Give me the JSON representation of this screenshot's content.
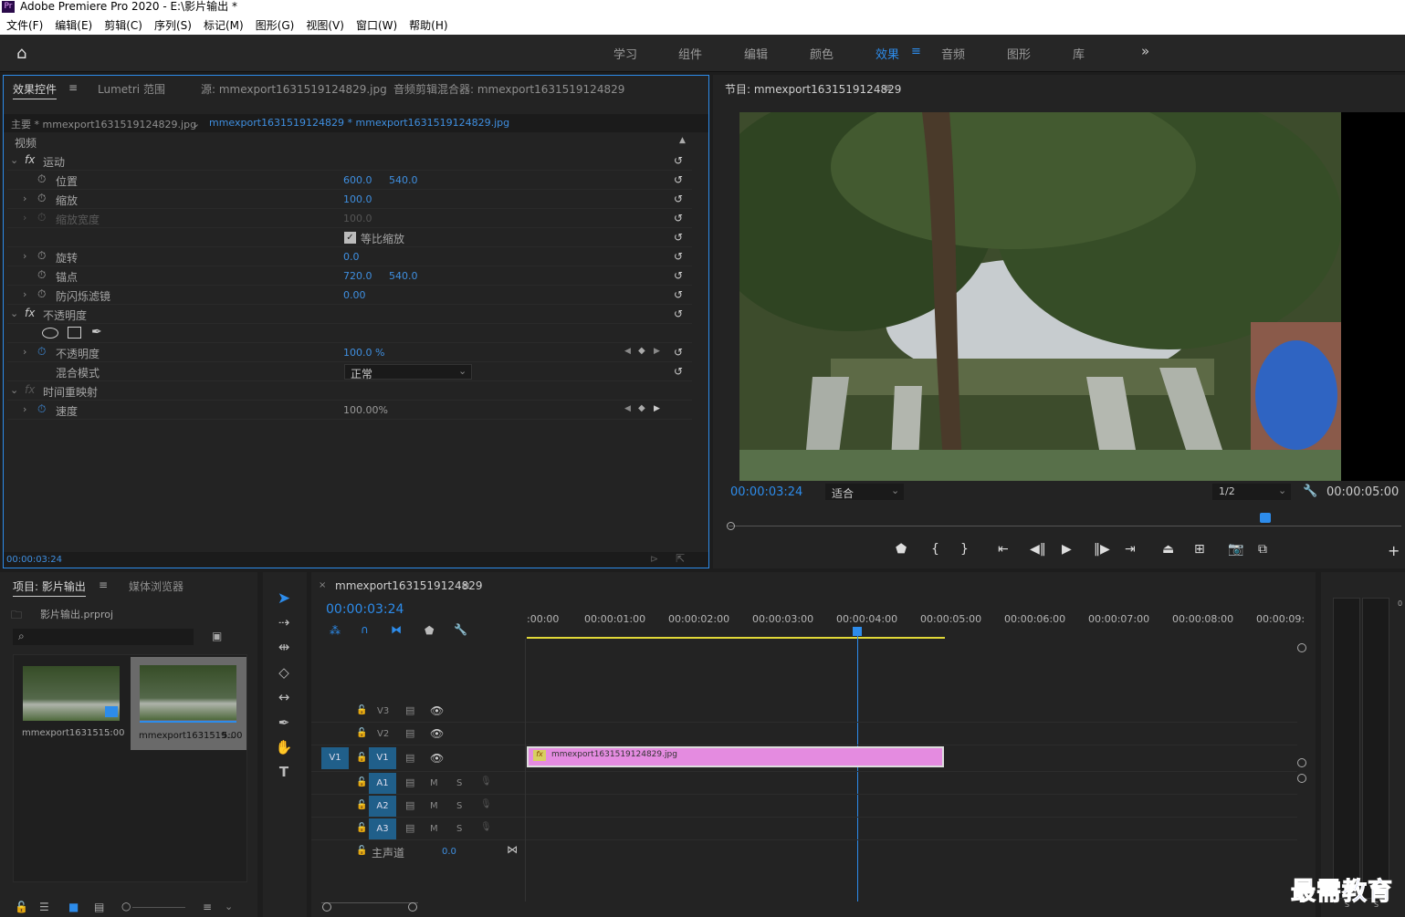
{
  "app": {
    "title": "Adobe Premiere Pro 2020 - E:\\影片输出 *",
    "logo": "Pr"
  },
  "menu": [
    "文件(F)",
    "编辑(E)",
    "剪辑(C)",
    "序列(S)",
    "标记(M)",
    "图形(G)",
    "视图(V)",
    "窗口(W)",
    "帮助(H)"
  ],
  "workspaces": [
    "学习",
    "组件",
    "编辑",
    "颜色",
    "效果",
    "音频",
    "图形",
    "库"
  ],
  "effects_panel": {
    "tabs": [
      "效果控件",
      "Lumetri 范围",
      "源: mmexport1631519124829.jpg",
      "音频剪辑混合器: mmexport1631519124829"
    ],
    "source": "主要 * mmexport1631519124829.jpg",
    "sequence": "mmexport1631519124829 * mmexport1631519124829.jpg",
    "video_label": "视频",
    "motion": "运动",
    "position": {
      "label": "位置",
      "x": "600.0",
      "y": "540.0"
    },
    "scale": {
      "label": "缩放",
      "value": "100.0"
    },
    "scale_width": {
      "label": "缩放宽度",
      "value": "100.0"
    },
    "uniform": "等比缩放",
    "rotation": {
      "label": "旋转",
      "value": "0.0"
    },
    "anchor": {
      "label": "锚点",
      "x": "720.0",
      "y": "540.0"
    },
    "flicker": {
      "label": "防闪烁滤镜",
      "value": "0.00"
    },
    "opacity_group": "不透明度",
    "opacity": {
      "label": "不透明度",
      "value": "100.0 %"
    },
    "blend": {
      "label": "混合模式",
      "value": "正常"
    },
    "time_remap": "时间重映射",
    "speed": {
      "label": "速度",
      "value": "100.00%"
    },
    "timecode": "00:00:03:24",
    "fx": "fx"
  },
  "program": {
    "title": "节目: mmexport1631519124829",
    "timecode": "00:00:03:24",
    "fit": "适合",
    "res": "1/2",
    "duration": "00:00:05:00"
  },
  "project": {
    "tabs": [
      "项目: 影片输出",
      "媒体浏览器"
    ],
    "file": "影片输出.prproj",
    "items": [
      {
        "name": "mmexport163151...",
        "dur": "5:00"
      },
      {
        "name": "mmexport1631519...",
        "dur": "5:00"
      }
    ]
  },
  "timeline": {
    "tab": "mmexport1631519124829",
    "timecode": "00:00:03:24",
    "ruler": [
      ":00:00",
      "00:00:01:00",
      "00:00:02:00",
      "00:00:03:00",
      "00:00:04:00",
      "00:00:05:00",
      "00:00:06:00",
      "00:00:07:00",
      "00:00:08:00",
      "00:00:09:"
    ],
    "video_tracks": [
      "V3",
      "V2",
      "V1"
    ],
    "audio_tracks": [
      "A1",
      "A2",
      "A3"
    ],
    "src_v": "V1",
    "master": "主声道",
    "master_val": "0.0",
    "clip": "mmexport1631519124829.jpg",
    "m": "M",
    "s": "S"
  },
  "watermark": "最需教育",
  "meter_labels": [
    "0",
    "S",
    "S"
  ],
  "colors": {
    "accent": "#2d8ceb",
    "clip": "#e48be0",
    "panel_border": "#2d8ceb"
  }
}
